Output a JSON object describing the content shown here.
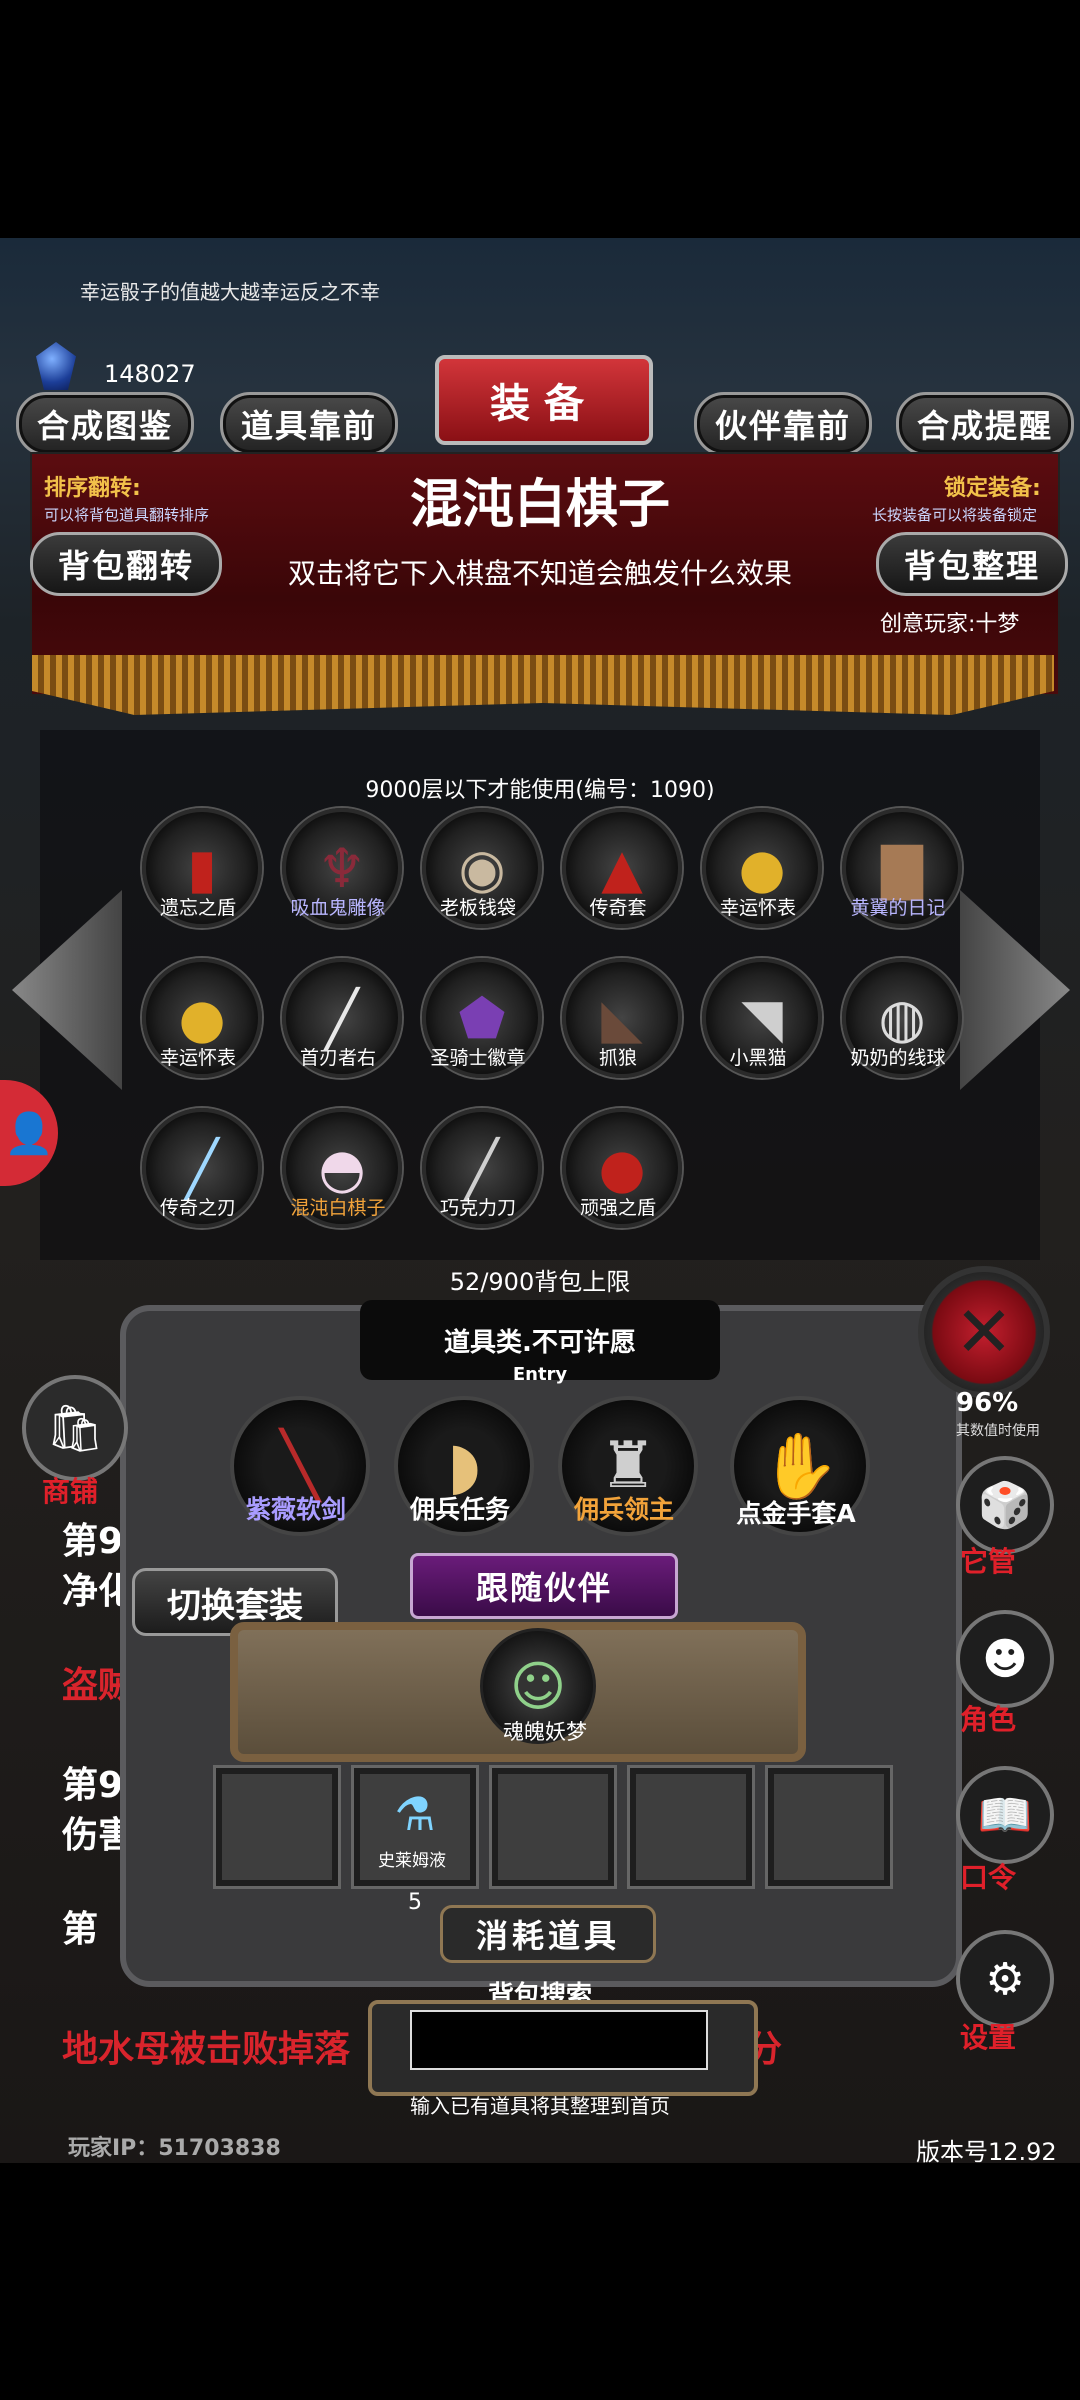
{
  "header": {
    "flavor_text": "幸运骰子的值越大越幸运反之不幸",
    "gem_count": "148027",
    "title": "装备",
    "nav_buttons": [
      "合成图鉴",
      "道具靠前",
      "伙伴靠前",
      "合成提醒"
    ]
  },
  "item_panel": {
    "sort_flip_title": "排序翻转:",
    "sort_flip_desc": "可以将背包道具翻转排序",
    "lock_title": "锁定装备:",
    "lock_desc": "长按装备可以将装备锁定",
    "flip_button": "背包翻转",
    "sort_button": "背包整理",
    "item_name": "混沌白棋子",
    "item_desc": "双击将它下入棋盘不知道会触发什么效果",
    "creator": "创意玩家:十梦"
  },
  "inventory": {
    "requirement": "9000层以下才能使用(编号：1090)",
    "capacity": "52/900背包上限",
    "items": [
      {
        "label": "遗忘之盾",
        "color": "#ffffff",
        "icon": "red-shield-icon"
      },
      {
        "label": "吸血鬼雕像",
        "color": "#b9b6ff",
        "icon": "vampire-statue-icon"
      },
      {
        "label": "老板钱袋",
        "color": "#ffffff",
        "icon": "money-bag-icon"
      },
      {
        "label": "传奇套",
        "color": "#ffffff",
        "icon": "red-robe-icon"
      },
      {
        "label": "幸运怀表",
        "color": "#ffffff",
        "icon": "pocket-watch-icon"
      },
      {
        "label": "黄翼的日记",
        "color": "#b9b6ff",
        "icon": "diary-icon"
      },
      {
        "label": "幸运怀表",
        "color": "#ffffff",
        "icon": "pocket-watch-icon"
      },
      {
        "label": "首刃者右",
        "color": "#ffffff",
        "icon": "blade-icon"
      },
      {
        "label": "圣骑士徽章",
        "color": "#ffffff",
        "icon": "paladin-badge-icon"
      },
      {
        "label": "抓狼",
        "color": "#ffffff",
        "icon": "wolf-icon"
      },
      {
        "label": "小黑猫",
        "color": "#ffffff",
        "icon": "black-cat-icon"
      },
      {
        "label": "奶奶的线球",
        "color": "#ffffff",
        "icon": "yarn-ball-icon"
      },
      {
        "label": "传奇之刃",
        "color": "#ffffff",
        "icon": "legend-blade-icon"
      },
      {
        "label": "混沌白棋子",
        "color": "#f2a33a",
        "icon": "white-chess-piece-icon"
      },
      {
        "label": "巧克力刀",
        "color": "#ffffff",
        "icon": "chocolate-knife-icon"
      },
      {
        "label": "顽强之盾",
        "color": "#ffffff",
        "icon": "round-shield-icon"
      }
    ]
  },
  "entry": {
    "text": "道具类.不可许愿",
    "sub": "Entry"
  },
  "equipment": [
    {
      "label": "紫薇软剑",
      "color": "#a99cff",
      "icon": "sword-icon"
    },
    {
      "label": "佣兵任务",
      "color": "#ffffff",
      "icon": "horn-icon"
    },
    {
      "label": "佣兵领主",
      "color": "#f2a33a",
      "icon": "knight-icon"
    },
    {
      "label": "点金手套A",
      "color": "#ffffff",
      "icon": "glove-icon"
    }
  ],
  "sidebar": {
    "shop": "商铺",
    "items": [
      "它管",
      "角色",
      "口令",
      "设置"
    ],
    "hint_number": "96%",
    "hint_text": "其数值时使用"
  },
  "partner": {
    "switch_set": "切换套装",
    "follow_title": "跟随伙伴",
    "partner_name": "魂魄妖梦"
  },
  "consumables": {
    "title": "消耗道具",
    "slot2_name": "史莱姆液",
    "slot2_count": "5"
  },
  "search": {
    "title": "背包搜索",
    "placeholder": "",
    "hint": "输入已有道具将其整理到首页"
  },
  "log": {
    "line1": "第9",
    "line2": "净化",
    "line3": "盗贼",
    "line4": "第94",
    "line5": "伤害",
    "line6": "第",
    "line7": "地水母被击败掉落",
    "line7_tail": "分"
  },
  "footer": {
    "player_ip": "玩家IP：51703838",
    "version": "版本号12.92"
  }
}
